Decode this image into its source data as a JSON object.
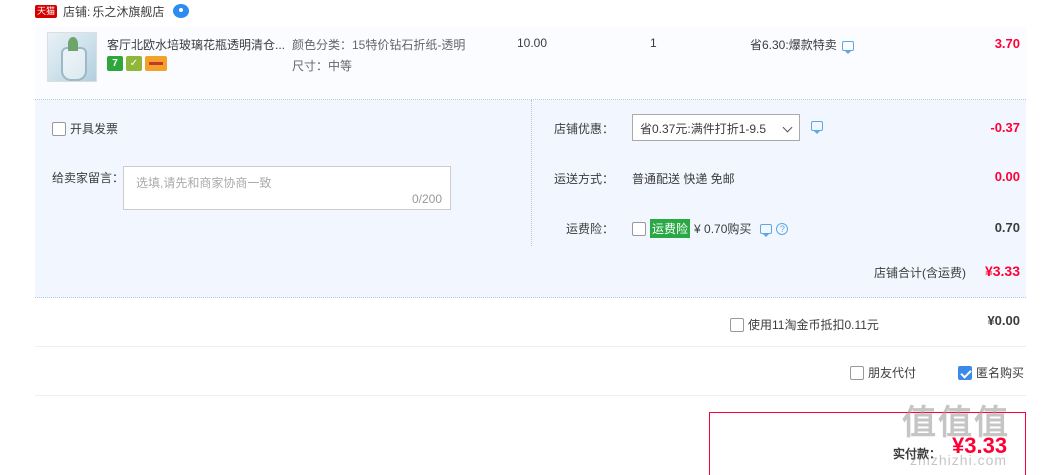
{
  "shop": {
    "logo_text": "天猫",
    "prefix": "店铺:",
    "name": "乐之沐旗舰店"
  },
  "item": {
    "title": "客厅北欧水培玻璃花瓶透明清仓...",
    "badge_1": "7",
    "spec_color": "颜色分类：15特价钻石折纸-透明",
    "spec_size": "尺寸：中等",
    "price": "10.00",
    "quantity": "1",
    "promo": "省6.30:爆款特卖",
    "total": "3.70"
  },
  "options": {
    "invoice_label": "开具发票",
    "message_label": "给卖家留言：",
    "message_placeholder": "选填,请先和商家协商一致",
    "message_count": "0/200",
    "discount_label": "店铺优惠：",
    "discount_selected": "省0.37元:满件打折1-9.5",
    "discount_value": "-0.37",
    "shipping_label": "运送方式：",
    "shipping_method": "普通配送 快递 免邮",
    "shipping_value": "0.00",
    "insurance_label": "运费险：",
    "insurance_tag": "运费险",
    "insurance_price": "¥ 0.70购买",
    "insurance_value": "0.70"
  },
  "shop_total": {
    "label": "店铺合计(含运费)",
    "value": "¥3.33"
  },
  "coin": {
    "label": "使用11淘金币抵扣0.11元",
    "value": "¥0.00"
  },
  "pay_options": {
    "friend_pay": "朋友代付",
    "anonymous": "匿名购买",
    "anonymous_checked": true
  },
  "final": {
    "label": "实付款：",
    "value": "¥3.33"
  },
  "watermark": {
    "main": "值值值",
    "sub": "zhizhizhi.com"
  },
  "colors": {
    "accent_red": "#ff0036",
    "panel_bg": "#f2f7ff",
    "link_blue": "#3b8ae8"
  }
}
